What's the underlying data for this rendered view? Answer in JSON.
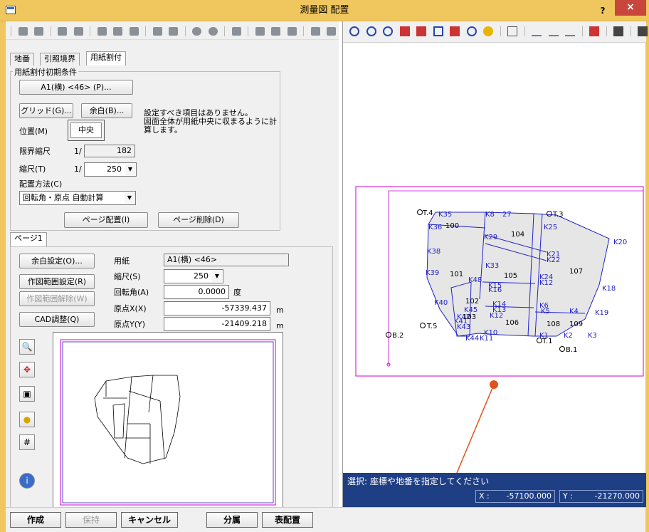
{
  "window": {
    "title": "測量図 配置",
    "help": "?",
    "close": "×"
  },
  "tabs": [
    "地番",
    "引照境界",
    "用紙割付"
  ],
  "initial": {
    "group_title": "用紙割付初期条件",
    "paper_button": "A1(横) <46> (P)...",
    "grid_button": "グリッド(G)...",
    "margin_button": "余白(B)...",
    "position_label": "位置(M)",
    "position_value": "中央",
    "info_line1": "設定すべき項目はありません。",
    "info_line2": "図面全体が用紙中央に収まるように計",
    "info_line3": "算します。",
    "limit_scale_label": "限界縮尺",
    "limit_scale_prefix": "1/",
    "limit_scale_value": "182",
    "scale_label": "縮尺(T)",
    "scale_prefix": "1/",
    "scale_value": "250",
    "method_label": "配置方法(C)",
    "method_value": "回転角・原点 自動計算"
  },
  "actions": {
    "page_layout": "ページ配置(I)",
    "page_delete": "ページ削除(D)"
  },
  "page": {
    "tab": "ページ1",
    "margin_setting": "余白設定(O)...",
    "range_setting": "作図範囲設定(R)",
    "range_clear": "作図範囲解除(W)",
    "cad_adjust": "CAD調整(Q)",
    "paper_label": "用紙",
    "paper_value": "A1(横) <46>",
    "scale_label": "縮尺(S)",
    "scale_value": "250",
    "rotation_label": "回転角(A)",
    "rotation_value": "0.0000",
    "rotation_unit": "度",
    "origin_x_label": "原点X(X)",
    "origin_x_value": "-57339.437",
    "origin_x_unit": "m",
    "origin_y_label": "原点Y(Y)",
    "origin_y_value": "-21409.218",
    "origin_y_unit": "m"
  },
  "bottom": {
    "create": "作成",
    "hold": "保持",
    "cancel": "キャンセル",
    "separate": "分属",
    "table_layout": "表配置"
  },
  "map": {
    "labels": [
      "T.4",
      "K35",
      "K8",
      "27",
      "T.3",
      "K36",
      "100",
      "K29",
      "104",
      "K25",
      "K20",
      "K38",
      "K21",
      "K22",
      "K33",
      "107",
      "K39",
      "101",
      "K48",
      "105",
      "K24",
      "K12",
      "K18",
      "K15",
      "K16",
      "102",
      "K40",
      "K45",
      "K14",
      "K13",
      "K6",
      "K5",
      "K4",
      "K19",
      "K42",
      "K41",
      "K12",
      "106",
      "108",
      "109",
      "T.5",
      "K43",
      "K10",
      "K1",
      "K2",
      "K3",
      "B.2",
      "K44",
      "K11",
      "T.1",
      "B.1",
      "103"
    ]
  },
  "status": {
    "message": "選択: 座標や地番を指定してください",
    "x_label": "X :",
    "x_value": "-57100.000",
    "y_label": "Y :",
    "y_value": "-21270.000"
  },
  "colors": {
    "titlebar": "#f0c75e",
    "status": "#1f3f85",
    "paper_frame": "#d000d0",
    "survey_blue": "#2222cc",
    "marker": "#e2511a"
  }
}
